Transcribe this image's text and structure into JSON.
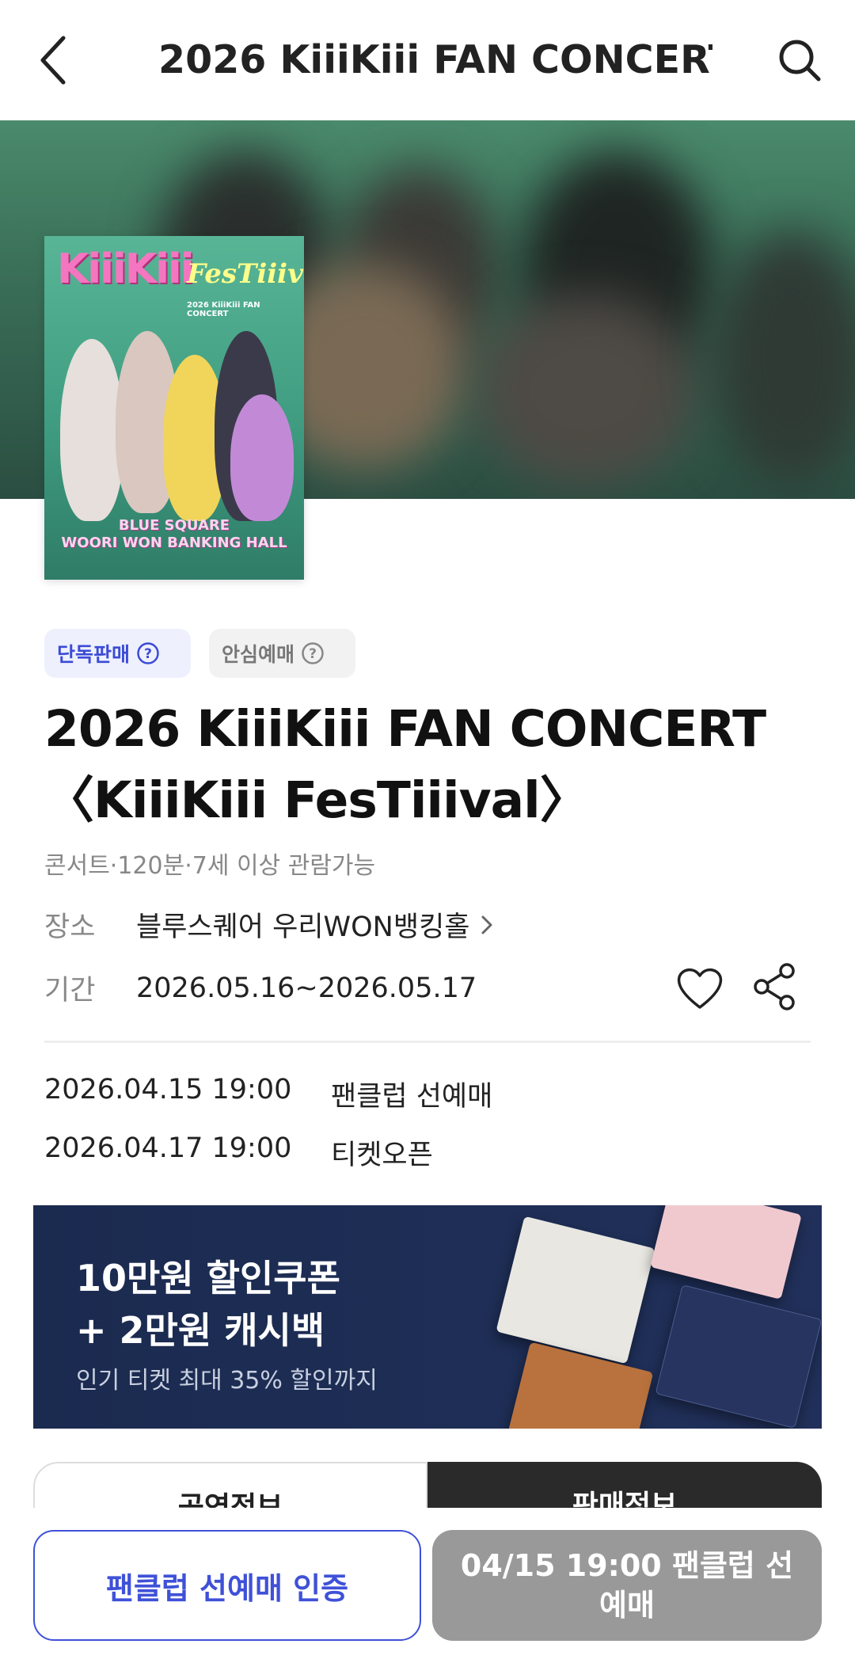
{
  "header": {
    "title": "2026 KiiiKiii FAN CONCERT…",
    "back_icon": "chevron-left-icon",
    "search_icon": "search-icon"
  },
  "poster": {
    "logo": "KiiiKiii",
    "festival": "FesTiiival",
    "subtitle": "2026 KiiiKiii FAN CONCERT",
    "venue_line1": "BLUE SQUARE",
    "venue_line2": "WOORI WON BANKING HALL"
  },
  "badges": [
    {
      "label": "단독판매",
      "icon": "question-circle-icon"
    },
    {
      "label": "안심예매",
      "icon": "question-circle-icon"
    }
  ],
  "event": {
    "title": "2026 KiiiKiii FAN CONCERT 〈KiiiKiii FesTiiival〉",
    "meta": "콘서트·120분·7세 이상 관람가능",
    "place_label": "장소",
    "place_value": "블루스퀘어 우리WON뱅킹홀",
    "period_label": "기간",
    "period_value": "2026.05.16~2026.05.17"
  },
  "schedule": [
    {
      "time": "2026.04.15 19:00",
      "label": "팬클럽 선예매"
    },
    {
      "time": "2026.04.17 19:00",
      "label": "티켓오픈"
    }
  ],
  "banner": {
    "line1": "10만원 할인쿠폰",
    "line2": "+ 2만원 캐시백",
    "sub": "인기 티켓 최대 35% 할인까지"
  },
  "tabs": [
    "공연정보",
    "판매정보"
  ],
  "bottom": {
    "auth_button": "팬클럽 선예매 인증",
    "presale_button": "04/15 19:00 팬클럽 선예매"
  },
  "colors": {
    "accent": "#3f51d8",
    "disabled": "#999999",
    "banner_bg": "#1e2e56"
  }
}
